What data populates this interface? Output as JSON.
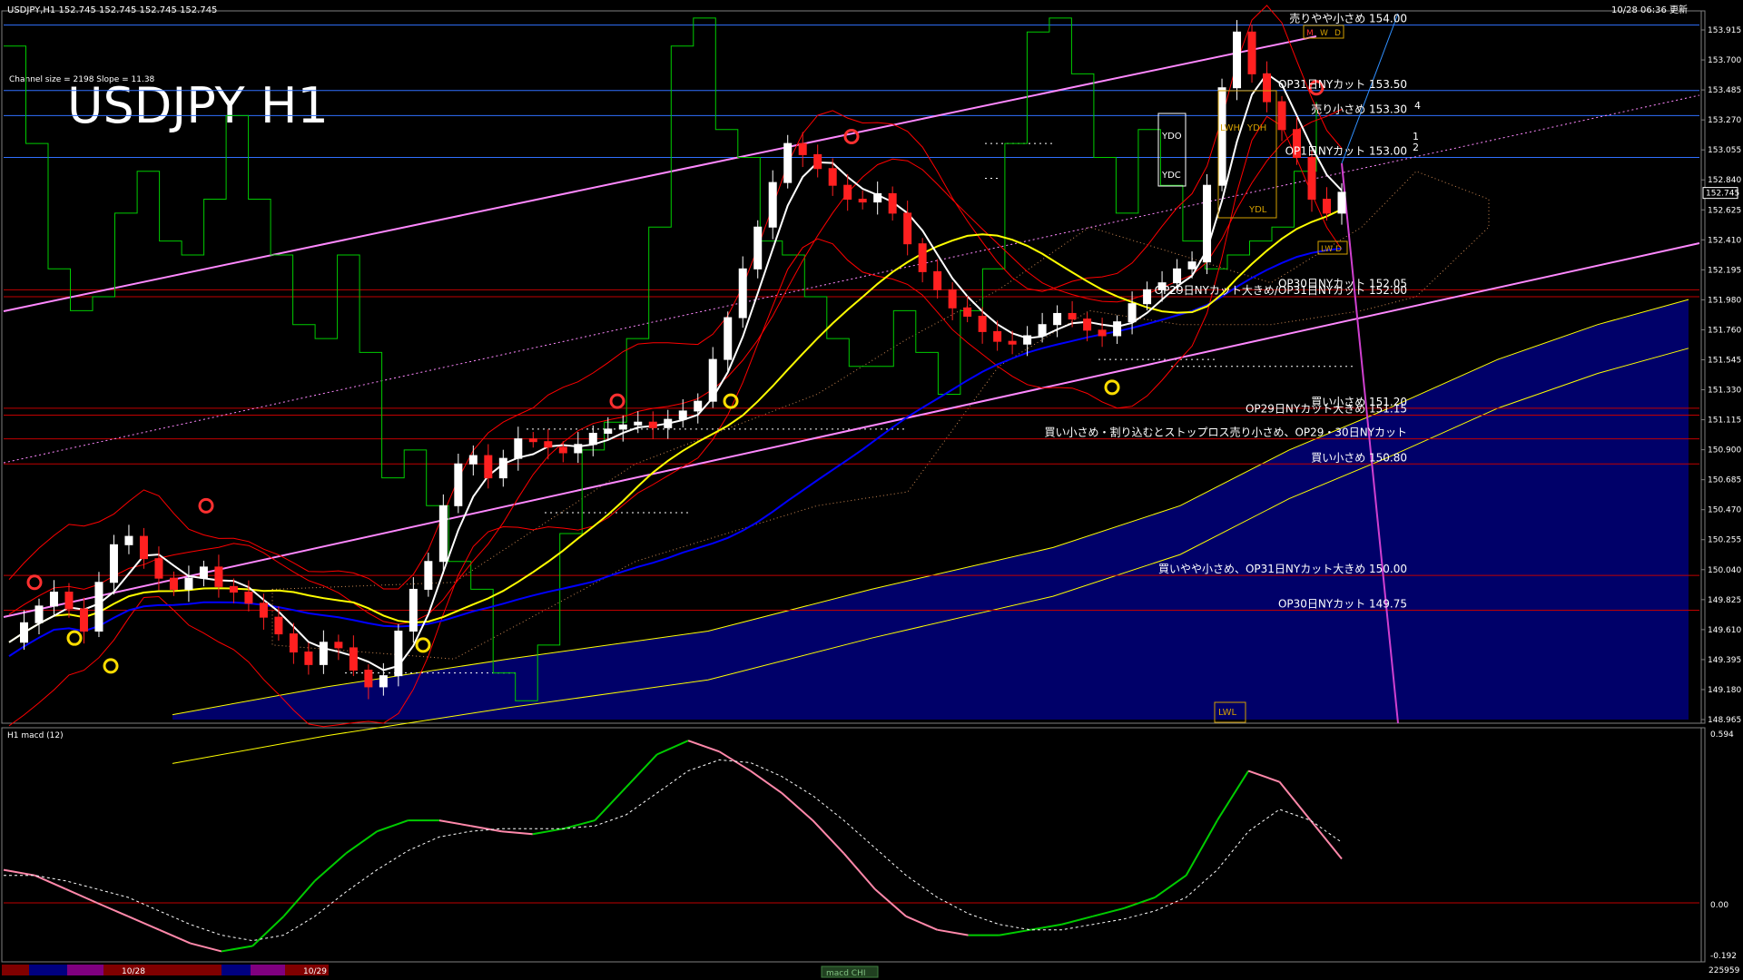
{
  "header": {
    "symbol_line": "USDJPY,H1  152.745 152.745 152.745 152.745",
    "timestamp": "10/28 06:36 更新",
    "channel_info": "Channel size = 2198 Slope = 11.38",
    "big_title": "USDJPY H1"
  },
  "macd_panel": {
    "label": "H1  macd (12)",
    "ticks": [
      "0.594",
      "0.00",
      "-0.192"
    ]
  },
  "bottom": {
    "date_labels": [
      "10/28",
      "10/29"
    ],
    "volume": "225959",
    "tab_label": "macd CHI"
  },
  "box_labels": {
    "ydo": "YDO",
    "ydc": "YDC",
    "ydh": "YDH",
    "ydl": "YDL",
    "lwh": "LWH",
    "lwl": "LWL",
    "m": "M",
    "w": "W",
    "d": "D",
    "lw": "LW"
  },
  "channel_numbers": [
    "1",
    "2",
    "4"
  ],
  "colors": {
    "background": "#000000",
    "bull_candle": "#ffffff",
    "bear_candle": "#ff2020",
    "fast_ma": "#ffffff",
    "mid_ma": "#ffff00",
    "slow_ma": "#0000ff",
    "bollinger": "#ff0000",
    "momentum": "#00cc00",
    "channel": "#ff88ff",
    "cloud": "#0000c0",
    "macd_up": "#00cc00",
    "macd_down": "#ff88aa",
    "level_line_red": "#c00000",
    "level_line_blue": "#3070ff"
  },
  "chart_data": {
    "type": "candlestick",
    "symbol": "USDJPY",
    "timeframe": "H1",
    "ylim": [
      148.965,
      153.915
    ],
    "y_ticks": [
      "153.915",
      "153.700",
      "153.485",
      "153.270",
      "153.055",
      "152.840",
      "152.625",
      "152.410",
      "152.195",
      "151.980",
      "151.760",
      "151.545",
      "151.330",
      "151.115",
      "150.900",
      "150.685",
      "150.470",
      "150.255",
      "150.040",
      "149.825",
      "149.610",
      "149.395",
      "149.180",
      "148.965"
    ],
    "current_price": "152.745",
    "price_path": [
      149.52,
      149.66,
      149.78,
      149.88,
      149.76,
      149.6,
      149.95,
      150.22,
      150.28,
      150.12,
      149.98,
      149.9,
      149.98,
      150.06,
      149.92,
      149.88,
      149.8,
      149.7,
      149.58,
      149.45,
      149.36,
      149.52,
      149.48,
      149.32,
      149.2,
      149.28,
      149.6,
      149.9,
      150.1,
      150.5,
      150.8,
      150.86,
      150.7,
      150.84,
      150.98,
      150.96,
      150.92,
      150.88,
      150.94,
      151.02,
      151.05,
      151.08,
      151.1,
      151.06,
      151.12,
      151.18,
      151.25,
      151.55,
      151.85,
      152.2,
      152.5,
      152.82,
      153.1,
      153.02,
      152.92,
      152.8,
      152.7,
      152.68,
      152.74,
      152.6,
      152.38,
      152.18,
      152.05,
      151.92,
      151.86,
      151.75,
      151.68,
      151.66,
      151.72,
      151.8,
      151.88,
      151.84,
      151.76,
      151.72,
      151.82,
      151.95,
      152.05,
      152.1,
      152.2,
      152.25,
      152.8,
      153.5,
      153.9,
      153.6,
      153.4,
      153.2,
      153.0,
      152.7,
      152.6,
      152.75
    ],
    "series": [
      {
        "name": "macd",
        "values": [
          0.12,
          0.1,
          0.05,
          0.0,
          -0.05,
          -0.1,
          -0.15,
          -0.18,
          -0.16,
          -0.05,
          0.08,
          0.18,
          0.26,
          0.3,
          0.3,
          0.28,
          0.26,
          0.25,
          0.27,
          0.3,
          0.42,
          0.54,
          0.59,
          0.55,
          0.48,
          0.4,
          0.3,
          0.18,
          0.05,
          -0.05,
          -0.1,
          -0.12,
          -0.12,
          -0.1,
          -0.08,
          -0.05,
          -0.02,
          0.02,
          0.1,
          0.3,
          0.48,
          0.44,
          0.3,
          0.16
        ]
      },
      {
        "name": "signal",
        "values": [
          0.1,
          0.1,
          0.08,
          0.05,
          0.02,
          -0.03,
          -0.08,
          -0.12,
          -0.14,
          -0.12,
          -0.05,
          0.04,
          0.12,
          0.19,
          0.24,
          0.26,
          0.27,
          0.27,
          0.27,
          0.28,
          0.32,
          0.4,
          0.48,
          0.52,
          0.51,
          0.46,
          0.39,
          0.3,
          0.2,
          0.1,
          0.02,
          -0.04,
          -0.08,
          -0.1,
          -0.1,
          -0.08,
          -0.06,
          -0.03,
          0.02,
          0.12,
          0.26,
          0.34,
          0.3,
          0.22
        ]
      }
    ],
    "levels": [
      {
        "price": 153.95,
        "label": "売りやや小さめ 154.00",
        "color": "#3070ff"
      },
      {
        "price": 153.48,
        "label": "OP31日NYカット 153.50",
        "color": "#3070ff"
      },
      {
        "price": 153.3,
        "label": "売り小さめ 153.30",
        "color": "#3070ff"
      },
      {
        "price": 153.0,
        "label": "OP1日NYカット 153.00",
        "color": "#3070ff"
      },
      {
        "price": 152.05,
        "label": "OP30日NYカット 152.05",
        "color": "#c00000"
      },
      {
        "price": 152.0,
        "label": "OP29日NYカット大きめ/OP31日NYカット 152.00",
        "color": "#c00000"
      },
      {
        "price": 151.2,
        "label": "買い小さめ 151.20",
        "color": "#c00000"
      },
      {
        "price": 151.15,
        "label": "OP29日NYカット大きめ 151.15",
        "color": "#c00000"
      },
      {
        "price": 150.98,
        "label": "買い小さめ・割り込むとストップロス売り小さめ、OP29・30日NYカット",
        "color": "#c00000"
      },
      {
        "price": 150.8,
        "label": "買い小さめ 150.80",
        "color": "#c00000"
      },
      {
        "price": 150.0,
        "label": "買いやや小さめ、OP31日NYカット大きめ 150.00",
        "color": "#c00000"
      },
      {
        "price": 149.75,
        "label": "OP30日NYカット 149.75",
        "color": "#c00000"
      }
    ]
  }
}
